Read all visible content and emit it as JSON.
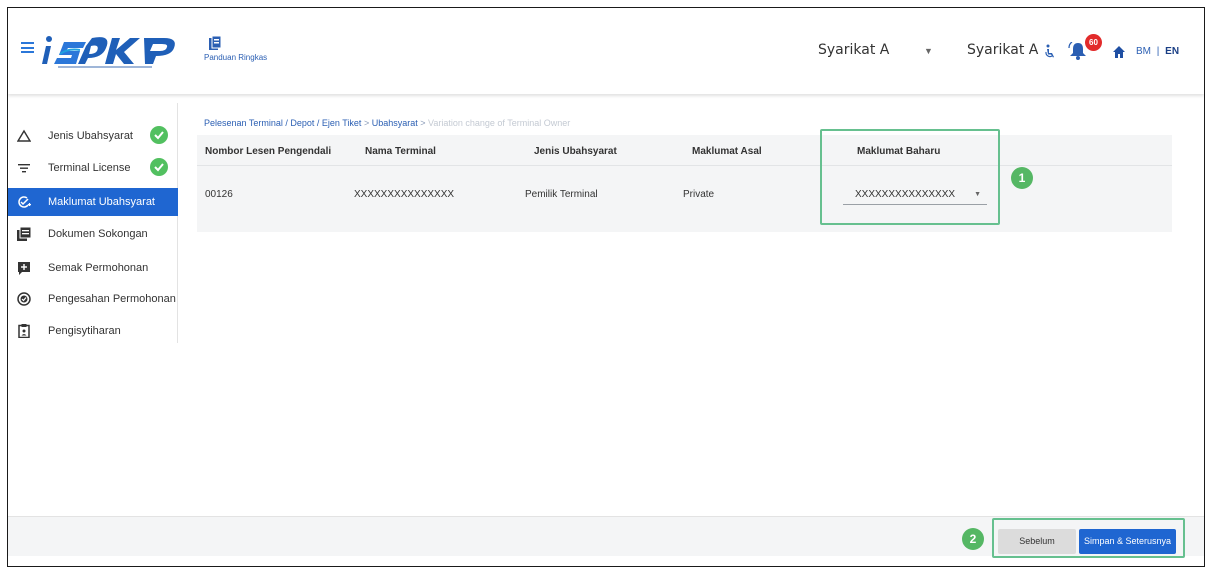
{
  "header": {
    "guide_label": "Panduan Ringkas",
    "company_1": "Syarikat A",
    "company_2": "Syarikat A",
    "notification_count": "60",
    "lang_bm": "BM",
    "lang_sep": "|",
    "lang_en": "EN"
  },
  "sidebar": {
    "items": [
      {
        "label": "Jenis Ubahsyarat",
        "icon": "triangle-icon",
        "completed": true
      },
      {
        "label": "Terminal License",
        "icon": "filter-icon",
        "completed": true
      },
      {
        "label": "Maklumat Ubahsyarat",
        "icon": "edit-check-icon",
        "active": true
      },
      {
        "label": "Dokumen Sokongan",
        "icon": "document-icon"
      },
      {
        "label": "Semak Permohonan",
        "icon": "review-icon"
      },
      {
        "label": "Pengesahan Permohonan",
        "icon": "verify-icon"
      },
      {
        "label": "Pengisytiharan",
        "icon": "clipboard-icon"
      }
    ]
  },
  "breadcrumb": {
    "part1": "Pelesenan Terminal / Depot / Ejen Tiket",
    "sep1": ">",
    "part2": "Ubahsyarat",
    "sep2": ">",
    "current": "Variation change of Terminal Owner"
  },
  "table": {
    "headers": [
      "Nombor Lesen Pengendali",
      "Nama Terminal",
      "Jenis Ubahsyarat",
      "Maklumat Asal",
      "Maklumat Baharu"
    ],
    "row": [
      "00126",
      "XXXXXXXXXXXXXXX",
      "Pemilik Terminal",
      "Private"
    ],
    "new_value": "XXXXXXXXXXXXXXX"
  },
  "markers": {
    "one": "1",
    "two": "2"
  },
  "footer": {
    "prev_label": "Sebelum",
    "next_label": "Simpan & Seterusnya"
  },
  "colors": {
    "primary": "#1f66d1",
    "success": "#52c060",
    "highlight": "#66c08f",
    "badge": "#e22b2b"
  }
}
